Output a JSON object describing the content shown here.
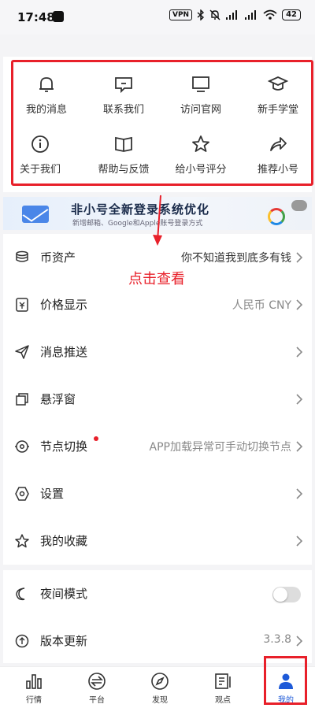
{
  "status_bar": {
    "time": "17:48",
    "vpn": "VPN",
    "battery": "42"
  },
  "quick_actions": [
    {
      "label": "我的消息",
      "icon": "bell-icon"
    },
    {
      "label": "联系我们",
      "icon": "message-icon"
    },
    {
      "label": "访问官网",
      "icon": "monitor-icon"
    },
    {
      "label": "新手学堂",
      "icon": "graduation-cap-icon"
    },
    {
      "label": "关于我们",
      "icon": "info-icon"
    },
    {
      "label": "帮助与反馈",
      "icon": "book-icon"
    },
    {
      "label": "给小号评分",
      "icon": "star-icon"
    },
    {
      "label": "推荐小号",
      "icon": "share-icon"
    }
  ],
  "banner": {
    "title": "非小号全新登录系统优化",
    "subtitle": "新增邮箱、Google和Apple账号登录方式"
  },
  "annotation": {
    "text": "点击查看"
  },
  "menu": [
    {
      "label": "币资产",
      "value": "你不知道我到底多有钱",
      "icon": "coins-icon"
    },
    {
      "label": "价格显示",
      "value": "人民币 CNY",
      "icon": "currency-icon"
    },
    {
      "label": "消息推送",
      "value": "",
      "icon": "send-icon"
    },
    {
      "label": "悬浮窗",
      "value": "",
      "icon": "window-icon"
    },
    {
      "label": "节点切换",
      "value": "APP加载异常可手动切换节点",
      "icon": "node-icon"
    },
    {
      "label": "设置",
      "value": "",
      "icon": "settings-icon"
    },
    {
      "label": "我的收藏",
      "value": "",
      "icon": "star-outline-icon"
    }
  ],
  "menu2": [
    {
      "label": "夜间模式",
      "icon": "moon-icon",
      "toggle_on": false
    },
    {
      "label": "版本更新",
      "value": "3.3.8",
      "icon": "update-icon"
    }
  ],
  "tabs": [
    {
      "label": "行情",
      "icon": "bar-chart-icon"
    },
    {
      "label": "平台",
      "icon": "exchange-icon"
    },
    {
      "label": "发现",
      "icon": "compass-icon"
    },
    {
      "label": "观点",
      "icon": "notes-icon"
    },
    {
      "label": "我的",
      "icon": "user-icon",
      "active": true
    }
  ],
  "colors": {
    "accent": "#1e5ad8",
    "highlight": "#e8202a"
  }
}
